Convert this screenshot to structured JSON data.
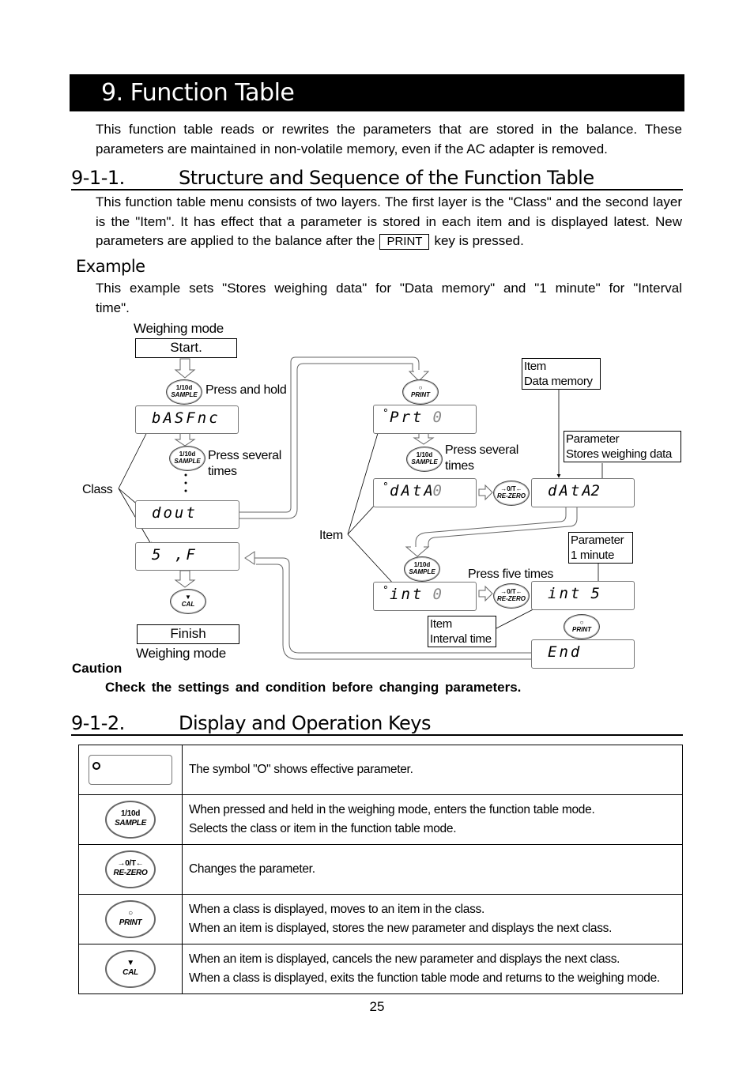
{
  "title": "9.  Function Table",
  "intro": "This function table reads or rewrites the parameters that are stored in the balance. These parameters are maintained in non-volatile memory, even if the AC adapter is removed.",
  "section1": {
    "number": "9-1-1.",
    "title": "Structure and Sequence of the Function Table",
    "body_before_key": "This function table menu consists of two layers. The first layer is the \"Class\" and the second layer is the \"Item\". It has effect that a parameter is stored in each item and is displayed latest. New parameters are applied to the balance after the",
    "key_label": "PRINT",
    "body_after_key": "key is pressed.",
    "example_heading": "Example",
    "example_text": "This example sets \"Stores weighing data\" for \"Data memory\" and \"1 minute\" for \"Interval time\"."
  },
  "diagram": {
    "start_caption": "Weighing mode",
    "start_box": "Start.",
    "finish_box": "Finish",
    "finish_caption": "Weighing mode",
    "press_and_hold": "Press and hold",
    "press_several_1": "Press several",
    "press_several_1b": "times",
    "press_several_2": "Press several",
    "press_several_2b": "times",
    "press_five": "Press five times",
    "class_label": "Class",
    "item_label": "Item",
    "displays": {
      "basfnc": "bASFnc",
      "dout": "dout",
      "sif": "5 ,F",
      "prt": "Prt",
      "prt_digit": "0",
      "data": "dAtA",
      "data_digit": "0",
      "data2": "dAtA",
      "data2_digit": "2",
      "int": "int",
      "int_digit": "0",
      "int2": "int",
      "int2_digit": "5",
      "end": "End"
    },
    "notes": {
      "item_data_memory": [
        "Item",
        "Data memory"
      ],
      "param_stores": [
        "Parameter",
        "Stores weighing data"
      ],
      "param_1min": [
        "Parameter",
        "1 minute"
      ],
      "item_interval": [
        "Item",
        "Interval time"
      ]
    },
    "keys": {
      "sample": [
        "1/10d",
        "SAMPLE"
      ],
      "print": [
        "○",
        "PRINT"
      ],
      "rezero": [
        "→0/T←",
        "RE-ZERO"
      ],
      "cal": [
        "▼",
        "CAL"
      ]
    }
  },
  "caution": {
    "heading": "Caution",
    "text": "Check the settings and condition before changing parameters."
  },
  "section2": {
    "number": "9-1-2.",
    "title": "Display and Operation Keys",
    "rows": [
      {
        "icon": "display-symbol",
        "lines": [
          "The symbol \"O\" shows effective parameter."
        ]
      },
      {
        "icon": "sample-key",
        "key": [
          "1/10d",
          "SAMPLE"
        ],
        "lines": [
          "When pressed and held in the weighing mode, enters the function table mode.",
          "Selects the class or item in the function table mode."
        ]
      },
      {
        "icon": "rezero-key",
        "key": [
          "→0/T←",
          "RE-ZERO"
        ],
        "lines": [
          "Changes the parameter."
        ]
      },
      {
        "icon": "print-key",
        "key": [
          "○",
          "PRINT"
        ],
        "lines": [
          "When a class is displayed, moves to an item in the class.",
          "When an item is displayed, stores the new parameter and displays the next class."
        ]
      },
      {
        "icon": "cal-key",
        "key": [
          "▼",
          "CAL"
        ],
        "lines": [
          "When an item is displayed, cancels the new parameter and displays the next class.",
          "When a class is displayed, exits the function table mode and returns to the weighing mode."
        ]
      }
    ]
  },
  "page_number": "25"
}
